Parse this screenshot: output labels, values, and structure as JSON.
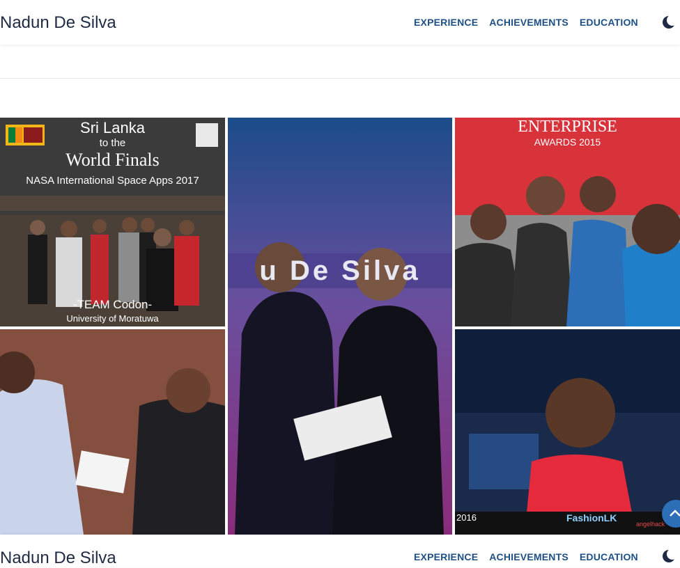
{
  "navbar": {
    "brand": "Nadun De Silva",
    "links": [
      "EXPERIENCE",
      "ACHIEVEMENTS",
      "EDUCATION"
    ],
    "theme_toggle_icon": "moon-icon"
  },
  "gallery": {
    "tile1": {
      "headline": "Sri Lanka",
      "sub": "to the",
      "title": "World Finals",
      "event": "NASA International Space Apps 2017",
      "team": "-TEAM Codon-",
      "university": "University of Moratuwa"
    },
    "tile2": {
      "banner": "u De Silva"
    },
    "tile3": {
      "banner": "ENTERPRISE",
      "banner_sub": "AWARDS 2015"
    },
    "tile5": {
      "caption": "2016",
      "brand": "FashionLK",
      "sponsor": "angelhack"
    }
  },
  "scroll_top_icon": "chevron-up-icon",
  "colors": {
    "nav_link": "#1e4f86",
    "brand": "#1f2a44",
    "accent": "#2d6fb6"
  }
}
